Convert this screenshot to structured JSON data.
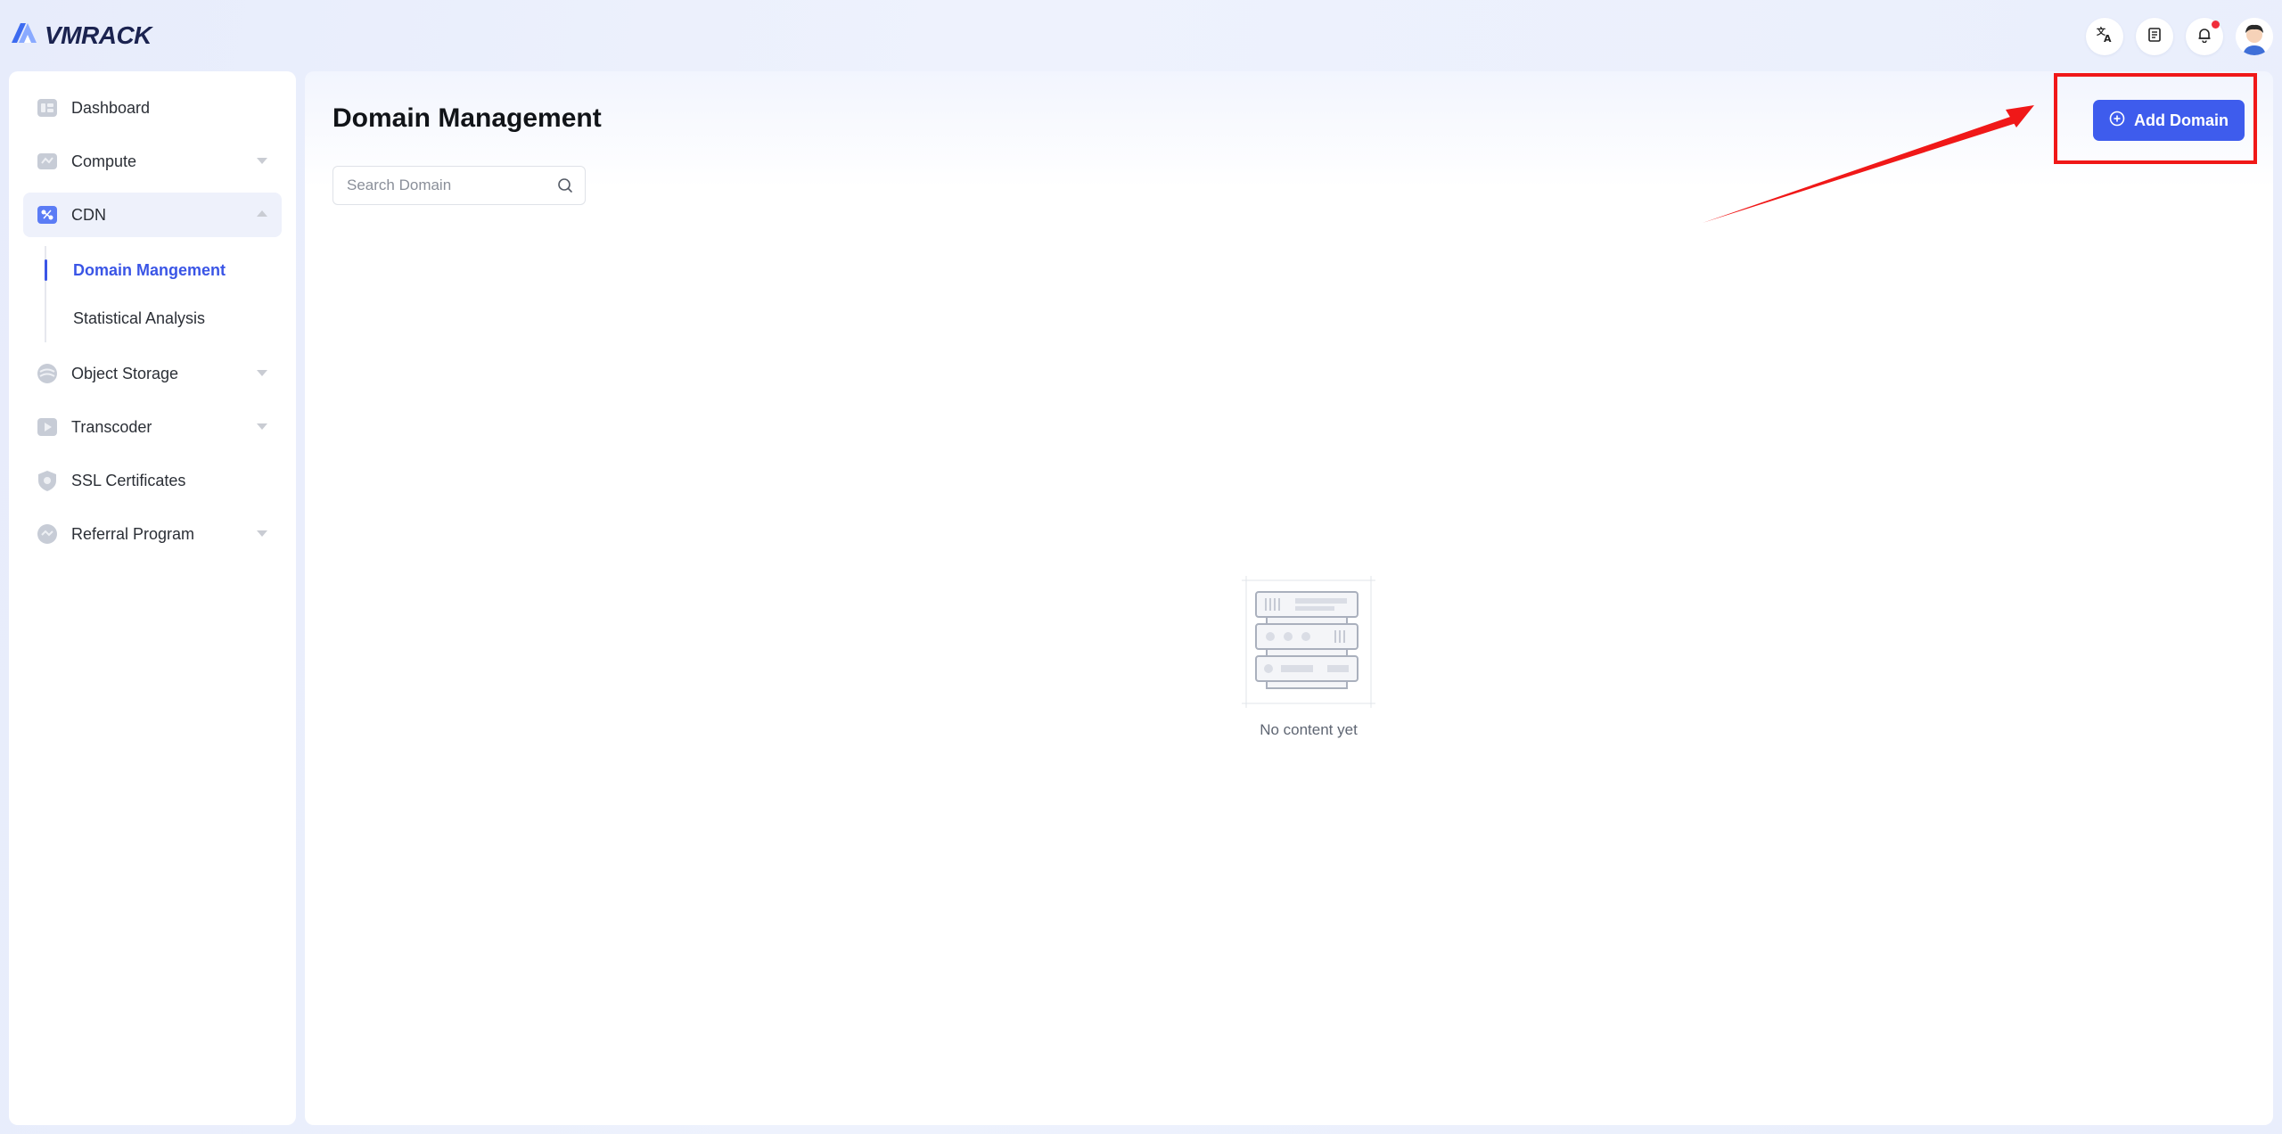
{
  "app": {
    "brand": "VMRACK"
  },
  "header": {
    "actions": [
      {
        "name": "translate-icon"
      },
      {
        "name": "document-icon"
      },
      {
        "name": "bell-icon",
        "has_notification": true
      }
    ]
  },
  "sidebar": {
    "items": [
      {
        "label": "Dashboard",
        "icon": "dashboard-icon"
      },
      {
        "label": "Compute",
        "icon": "compute-icon",
        "expandable": true
      },
      {
        "label": "CDN",
        "icon": "cdn-icon",
        "expanded": true
      },
      {
        "label": "Object Storage",
        "icon": "storage-icon",
        "expandable": true
      },
      {
        "label": "Transcoder",
        "icon": "transcoder-icon",
        "expandable": true
      },
      {
        "label": "SSL Certificates",
        "icon": "shield-icon"
      },
      {
        "label": "Referral Program",
        "icon": "referral-icon",
        "expandable": true
      }
    ],
    "cdn_sub": [
      {
        "label": "Domain Mangement",
        "active": true
      },
      {
        "label": "Statistical Analysis",
        "active": false
      }
    ]
  },
  "main": {
    "title": "Domain Management",
    "search_placeholder": "Search Domain",
    "add_button": "Add Domain",
    "empty_text": "No content yet"
  },
  "colors": {
    "accent": "#3e5ced",
    "annotation": "#f01818",
    "notification": "#f02d3a"
  }
}
